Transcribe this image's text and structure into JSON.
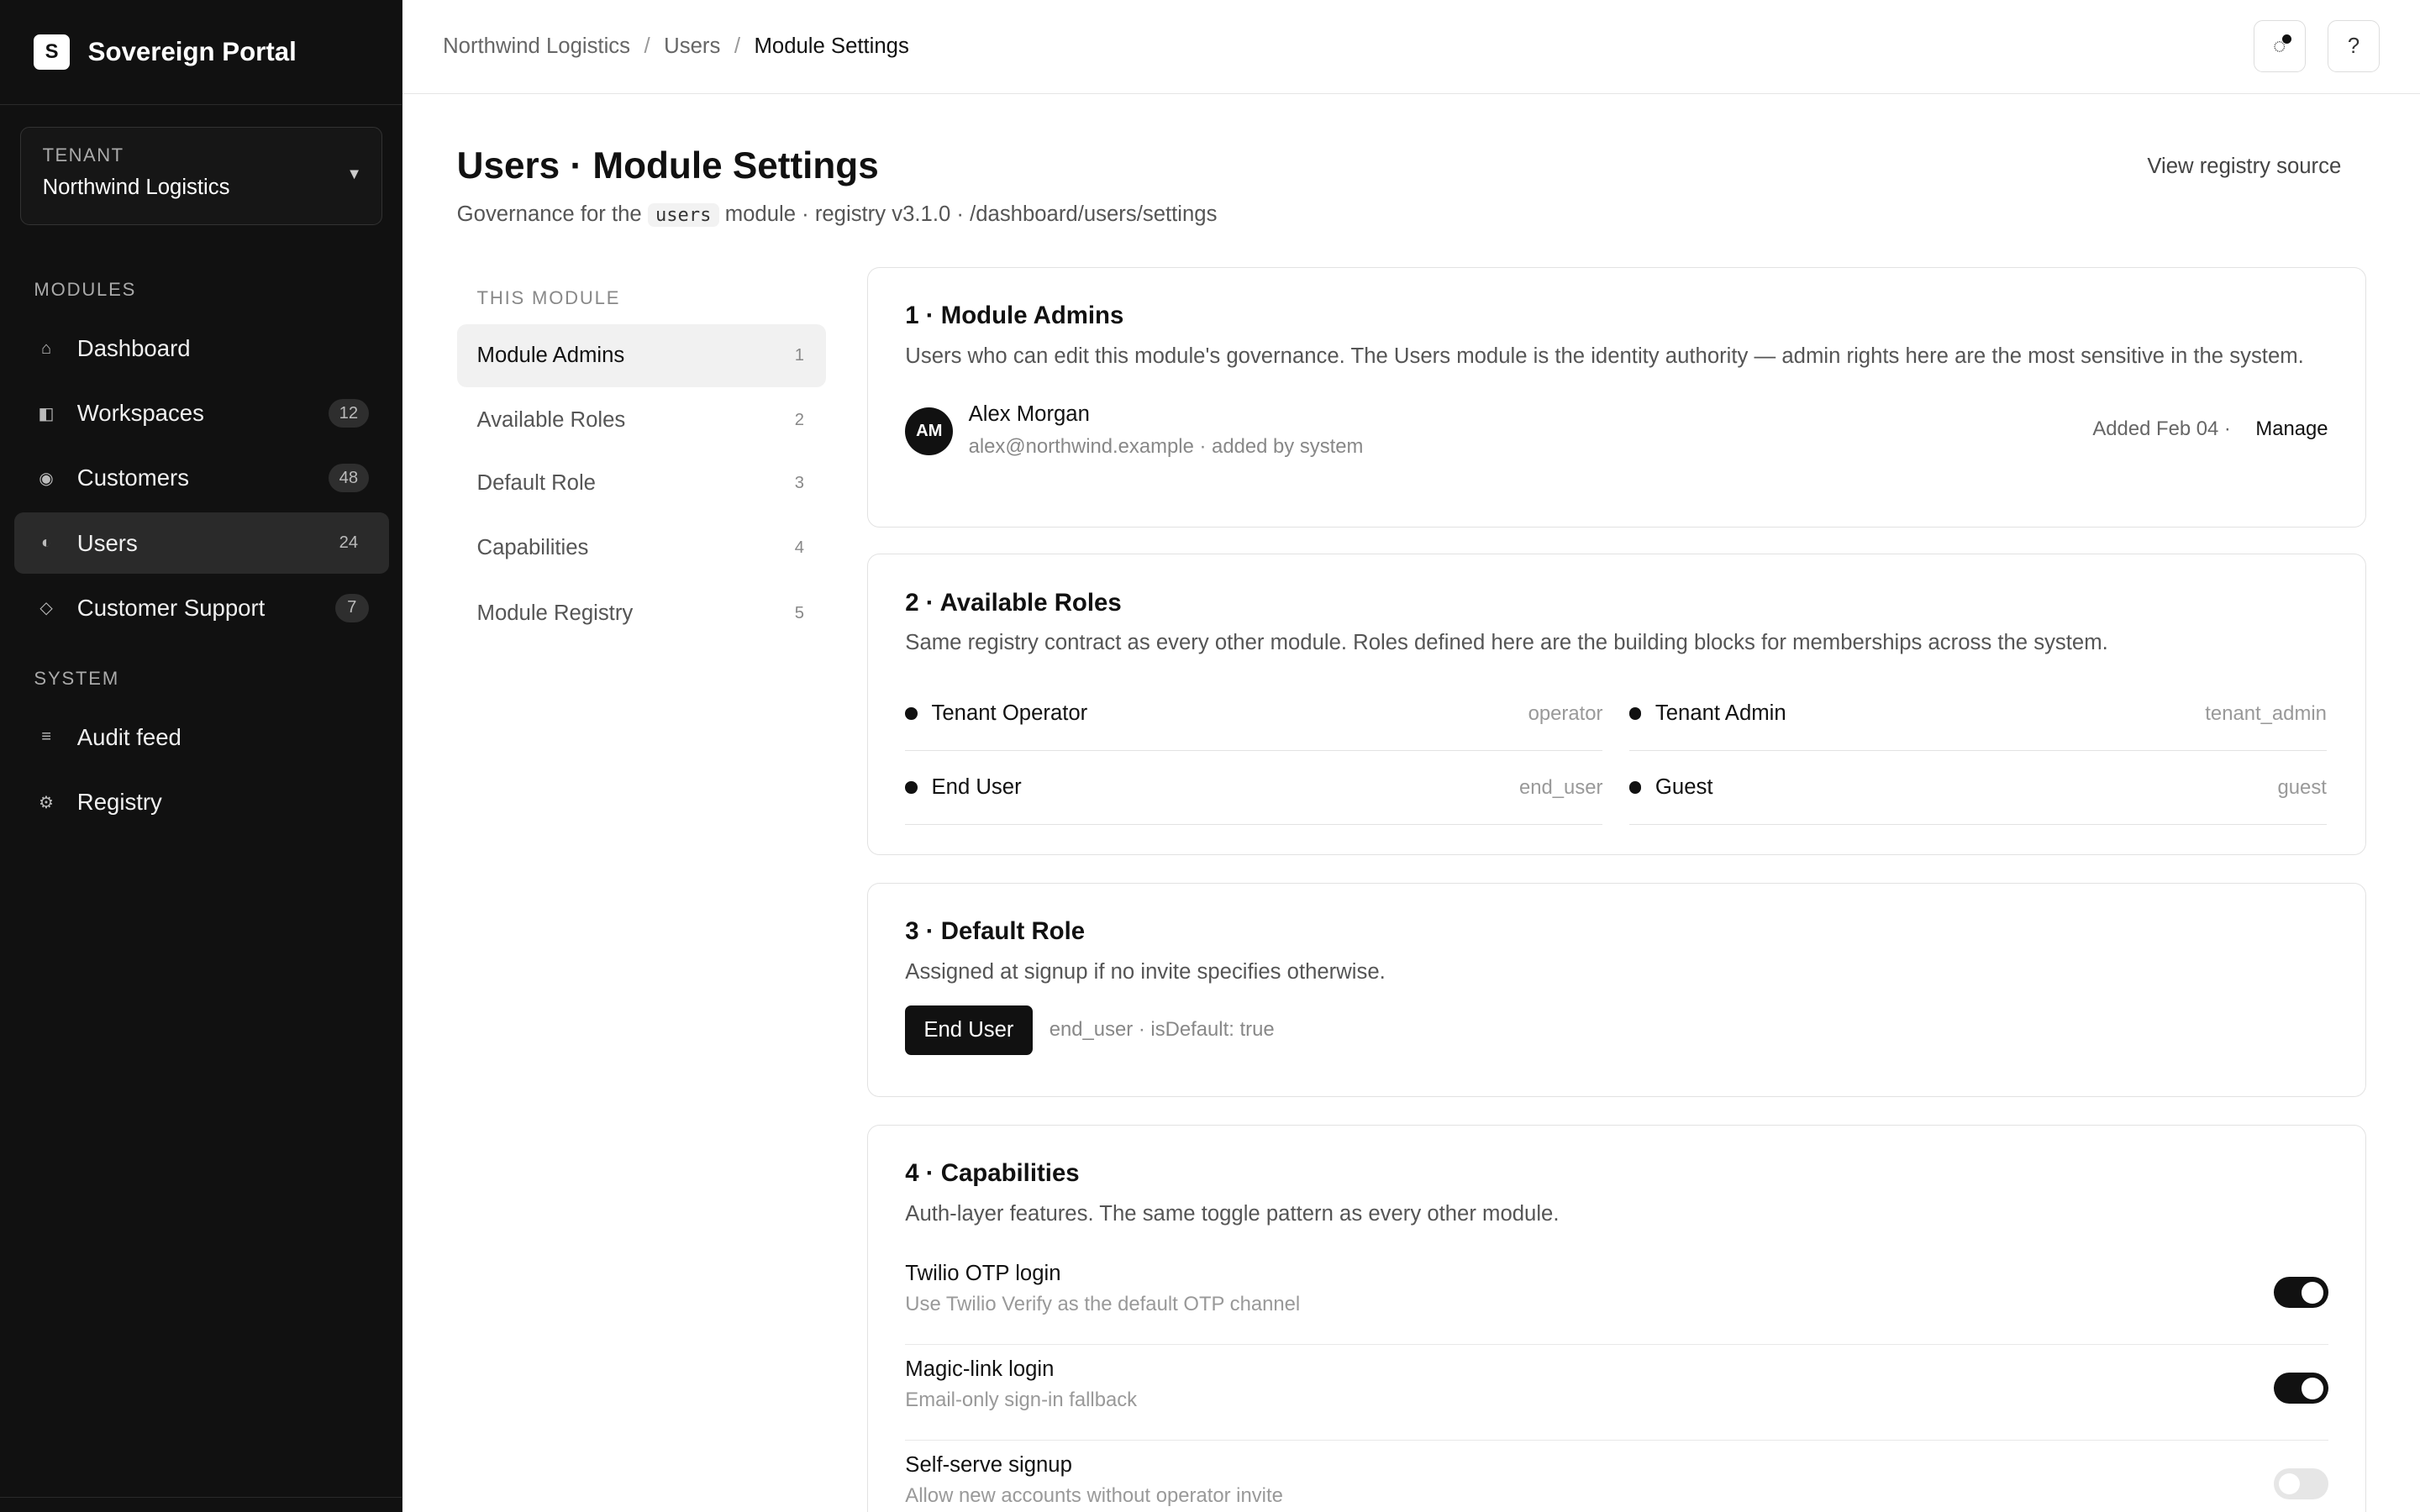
{
  "brand": {
    "logo_letter": "S",
    "name": "Sovereign Portal"
  },
  "tenant": {
    "label": "TENANT",
    "value": "Northwind Logistics"
  },
  "sidebar": {
    "modules_label": "MODULES",
    "system_label": "SYSTEM",
    "modules": [
      {
        "label": "Dashboard",
        "icon": "home-icon",
        "glyph": "⌂",
        "badge": ""
      },
      {
        "label": "Workspaces",
        "icon": "workspace-icon",
        "glyph": "◧",
        "badge": "12"
      },
      {
        "label": "Customers",
        "icon": "customers-icon",
        "glyph": "◉",
        "badge": "48"
      },
      {
        "label": "Users",
        "icon": "users-icon",
        "glyph": "◐",
        "badge": "24"
      },
      {
        "label": "Customer Support",
        "icon": "support-icon",
        "glyph": "◇",
        "badge": "7"
      }
    ],
    "system": [
      {
        "label": "Audit feed",
        "icon": "list-icon",
        "glyph": "≡"
      },
      {
        "label": "Registry",
        "icon": "gear-icon",
        "glyph": "⚙"
      }
    ]
  },
  "breadcrumb": [
    "Northwind Logistics",
    "Users",
    "Module Settings"
  ],
  "page": {
    "title": "Users · Module Settings",
    "sub_prefix": "Governance for the",
    "sub_code": "users",
    "sub_suffix": "module · registry v3.1.0 · /dashboard/users/settings",
    "view_source": "View registry source"
  },
  "local_nav": {
    "label": "THIS MODULE",
    "items": [
      {
        "label": "Module Admins",
        "num": "1"
      },
      {
        "label": "Available Roles",
        "num": "2"
      },
      {
        "label": "Default Role",
        "num": "3"
      },
      {
        "label": "Capabilities",
        "num": "4"
      },
      {
        "label": "Module Registry",
        "num": "5"
      }
    ]
  },
  "admins": {
    "title": "1 · Module Admins",
    "desc": "Users who can edit this module's governance. The Users module is the identity authority — admin rights here are the most sensitive in the system.",
    "items": [
      {
        "initials": "AM",
        "name": "Alex Morgan",
        "meta": "alex@northwind.example · added by system",
        "added": "Added Feb 04 ·",
        "manage": "Manage"
      }
    ]
  },
  "roles": {
    "title": "2 · Available Roles",
    "desc": "Same registry contract as every other module. Roles defined here are the building blocks for memberships across the system.",
    "items": [
      {
        "name": "Tenant Operator",
        "key": "operator"
      },
      {
        "name": "Tenant Admin",
        "key": "tenant_admin"
      },
      {
        "name": "End User",
        "key": "end_user"
      },
      {
        "name": "Guest",
        "key": "guest"
      }
    ]
  },
  "default_role": {
    "title": "3 · Default Role",
    "desc": "Assigned at signup if no invite specifies otherwise.",
    "role": "End User",
    "meta": "end_user · isDefault: true"
  },
  "capabilities": {
    "title": "4 · Capabilities",
    "desc": "Auth-layer features. The same toggle pattern as every other module.",
    "items": [
      {
        "name": "Twilio OTP login",
        "desc": "Use Twilio Verify as the default OTP channel",
        "on": true
      },
      {
        "name": "Magic-link login",
        "desc": "Email-only sign-in fallback",
        "on": true
      },
      {
        "name": "Self-serve signup",
        "desc": "Allow new accounts without operator invite",
        "on": false
      }
    ]
  },
  "topbar": {
    "activity_icon": "activity-icon",
    "help_label": "?"
  }
}
